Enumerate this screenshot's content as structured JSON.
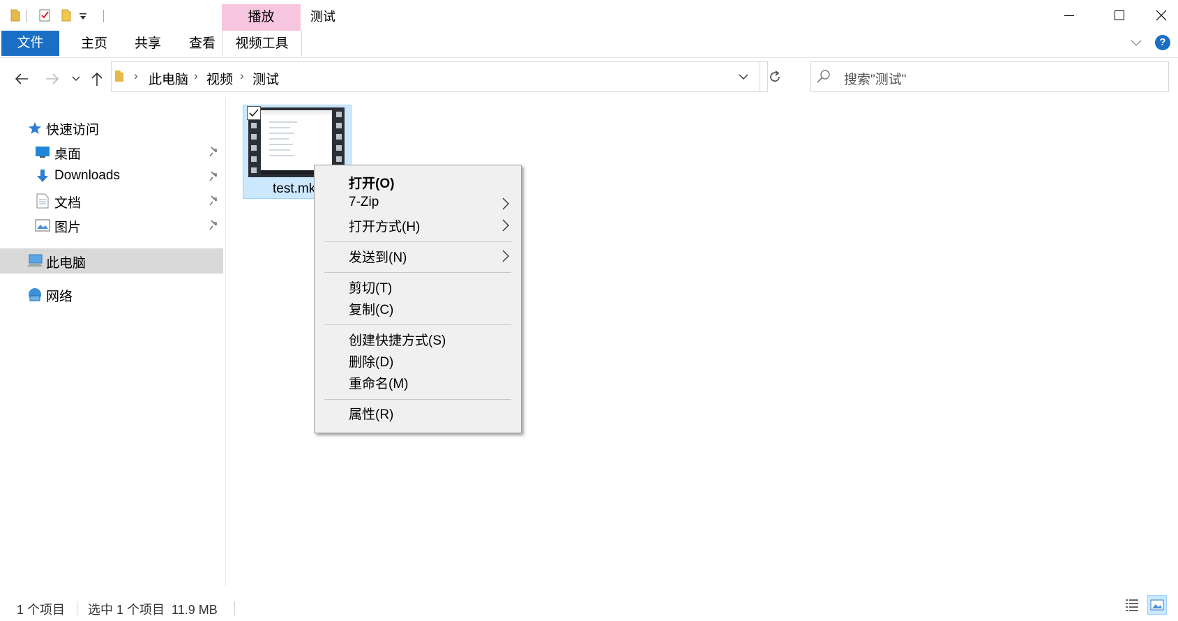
{
  "window": {
    "title": "测试",
    "minimize_symbol": "—",
    "maximize_symbol": "☐",
    "close_symbol": "✕"
  },
  "ribbon": {
    "contextual_group": "播放",
    "contextual_group_color": "#f6c6e0",
    "tabs": [
      "文件",
      "主页",
      "共享",
      "查看",
      "视频工具"
    ],
    "file_tab_color": "#1a6fc4",
    "help_symbol": "?"
  },
  "address": {
    "breadcrumbs": [
      "此电脑",
      "视频",
      "测试"
    ],
    "search_placeholder": "搜索\"测试\""
  },
  "nav": {
    "quick_access": "快速访问",
    "items": [
      {
        "label": "桌面",
        "icon": "desktop-icon",
        "pinned": true
      },
      {
        "label": "Downloads",
        "icon": "download-arrow-icon",
        "pinned": true
      },
      {
        "label": "文档",
        "icon": "document-icon",
        "pinned": true
      },
      {
        "label": "图片",
        "icon": "pictures-icon",
        "pinned": true
      }
    ],
    "this_pc": "此电脑",
    "network": "网络"
  },
  "files": [
    {
      "name": "test.mk",
      "selected": true,
      "checked": true
    }
  ],
  "context_menu": {
    "items": [
      {
        "label": "打开(O)",
        "bold": true,
        "submenu": false
      },
      {
        "label": "7-Zip",
        "submenu": true
      },
      {
        "label": "打开方式(H)",
        "submenu": true
      },
      {
        "label": "发送到(N)",
        "submenu": true
      },
      {
        "label": "剪切(T)",
        "submenu": false
      },
      {
        "label": "复制(C)",
        "submenu": false
      },
      {
        "label": "创建快捷方式(S)",
        "submenu": false
      },
      {
        "label": "删除(D)",
        "submenu": false
      },
      {
        "label": "重命名(M)",
        "submenu": false
      },
      {
        "label": "属性(R)",
        "submenu": false
      }
    ]
  },
  "status": {
    "item_count": "1 个项目",
    "selection": "选中 1 个项目  11.9 MB"
  }
}
